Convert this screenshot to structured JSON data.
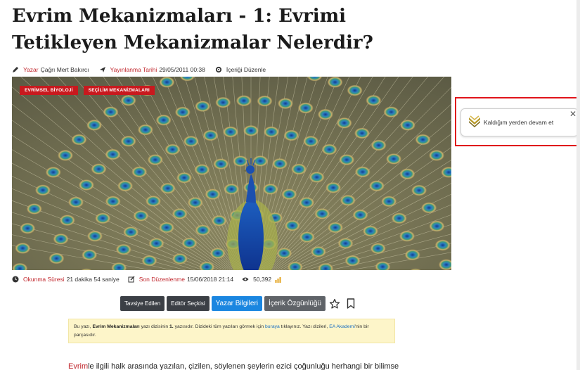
{
  "article": {
    "title": "Evrim Mekanizmaları - 1: Evrimi Tetikleyen Mekanizmalar Nelerdir?",
    "meta": {
      "author_label": "Yazar",
      "author_name": "Çağrı Mert Bakırcı",
      "published_label": "Yayınlanma Tarihi",
      "published_value": "29/05/2011 00:38",
      "edit_label": "İçeriği Düzenle"
    },
    "tags": [
      "EVRİMSEL BİYOLOJİ",
      "SEÇİLİM MEKANİZMALARI"
    ],
    "stats": {
      "reading_label": "Okunma Süresi",
      "reading_value": "21 dakika 54 saniye",
      "updated_label": "Son Düzenlenme",
      "updated_value": "15/06/2018 21:14",
      "views": "50,392"
    },
    "buttons": {
      "recommended": "Tavsiye Edilen",
      "editors_pick": "Editör Seçkisi",
      "author_info": "Yazar Bilgileri",
      "originality": "İçerik Özgünlüğü"
    },
    "notice": {
      "p1": "Bu yazı, ",
      "series": "Evrim Mekanizmaları",
      "p2": " yazı dizisinin ",
      "num": "1.",
      "p3": " yazısıdır. Dizideki tüm yazıları görmek için ",
      "link1": "buraya",
      "p4": " tıklayınız. Yazı dizileri, ",
      "link2": "EA Akademi",
      "p5": "'nin bir parçasıdır."
    },
    "body": {
      "link": "Evrim",
      "text": "le ilgili halk arasında yazılan, çizilen, söylenen şeylerin ezici çoğunluğu herhangi bir bilimsel"
    }
  },
  "resume": {
    "label": "Kaldığım yerden devam et",
    "close": "✕"
  },
  "colors": {
    "accent_red": "#c8191e",
    "label_red": "#c1272d",
    "blue_button": "#1a86e0",
    "dark_button": "#3b3f45",
    "notice_bg": "#fdf5c9",
    "highlight": "#e0141b"
  }
}
